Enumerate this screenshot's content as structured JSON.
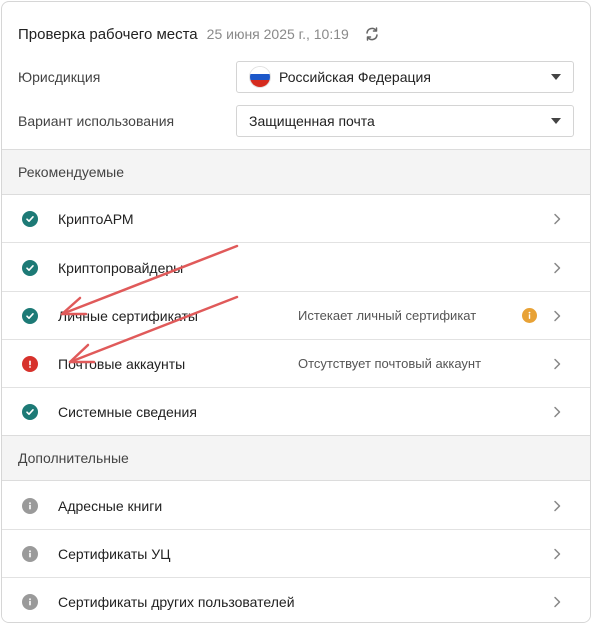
{
  "header": {
    "title": "Проверка рабочего места",
    "date": "25 июня 2025 г., 10:19"
  },
  "jurisdiction": {
    "label": "Юрисдикция",
    "value": "Российская Федерация",
    "flag_colors": [
      "#ffffff",
      "#1c57c9",
      "#d52b1e"
    ]
  },
  "usage": {
    "label": "Вариант использования",
    "value": "Защищенная почта"
  },
  "recommended": {
    "title": "Рекомендуемые",
    "items": [
      {
        "label": "КриптоАРМ",
        "status": "ok",
        "note": ""
      },
      {
        "label": "Криптопровайдеры",
        "status": "ok",
        "note": ""
      },
      {
        "label": "Личные сертификаты",
        "status": "ok",
        "note": "Истекает личный сертификат",
        "warning": true
      },
      {
        "label": "Почтовые аккаунты",
        "status": "error",
        "note": "Отсутствует почтовый аккаунт"
      },
      {
        "label": "Системные сведения",
        "status": "ok",
        "note": ""
      }
    ]
  },
  "additional": {
    "title": "Дополнительные",
    "items": [
      {
        "label": "Адресные книги",
        "status": "info"
      },
      {
        "label": "Сертификаты УЦ",
        "status": "info"
      },
      {
        "label": "Сертификаты других пользователей",
        "status": "info"
      }
    ]
  },
  "colors": {
    "ok": "#1d7a76",
    "error": "#d7322c",
    "info": "#9a9a9a",
    "warning": "#e8a236",
    "annotation_arrow": "#e05a5a"
  }
}
